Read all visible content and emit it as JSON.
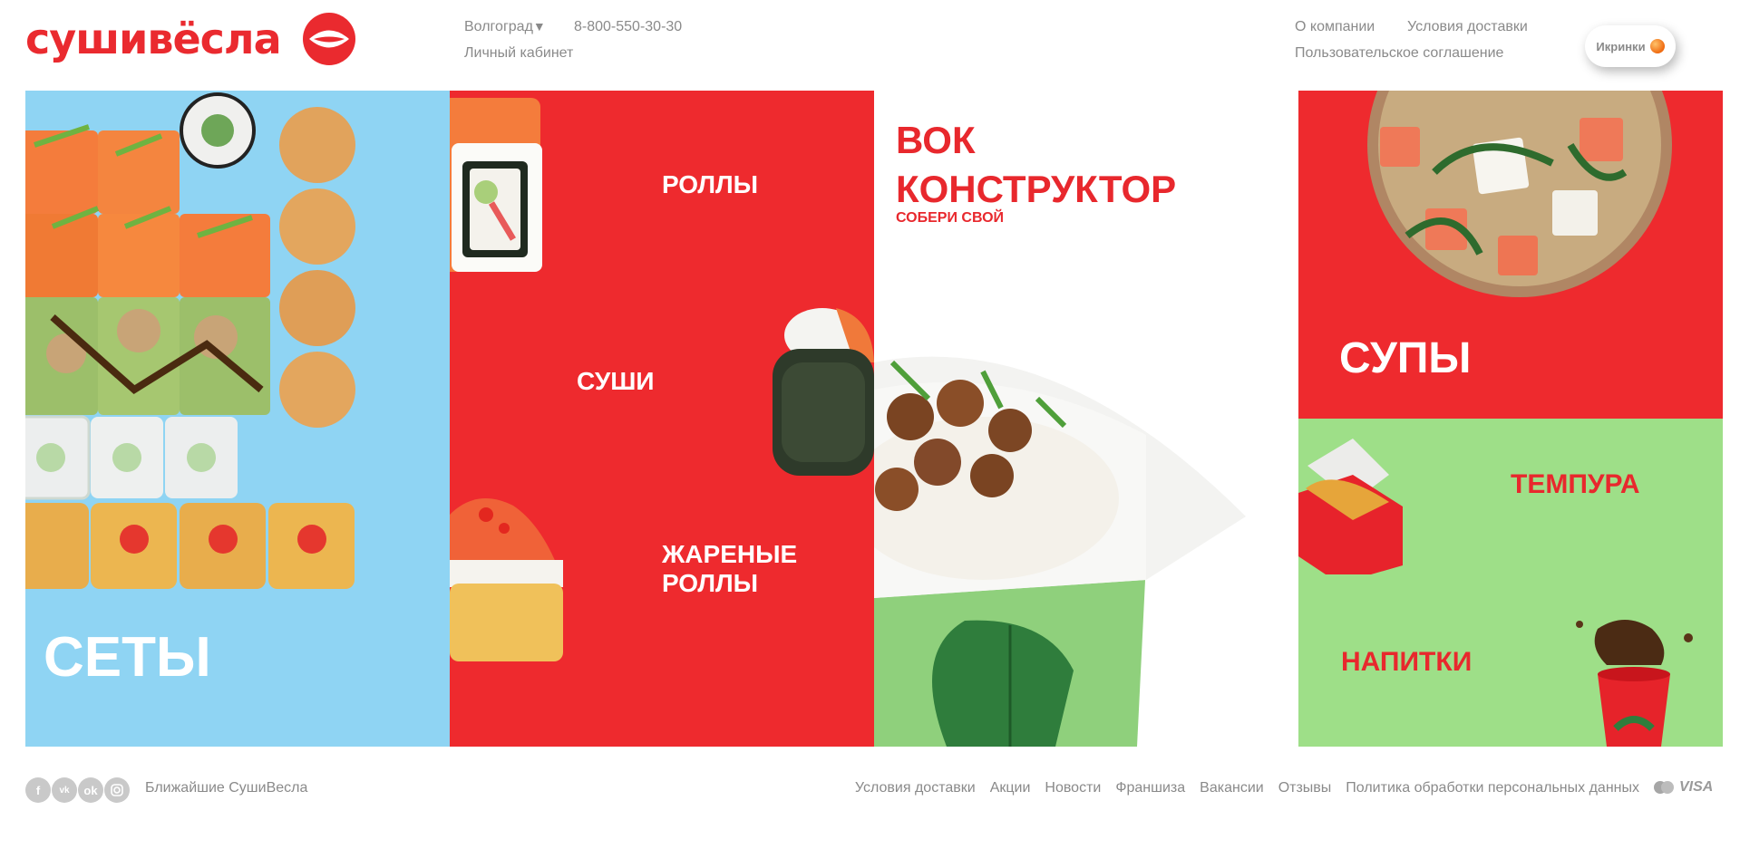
{
  "header": {
    "logo_text": "сушивёсла",
    "city": "Волгоград",
    "city_arrow": "▼",
    "phone": "8-800-550-30-30",
    "cabinet": "Личный кабинет",
    "about": "О компании",
    "delivery": "Условия доставки",
    "agreement": "Пользовательское соглашение",
    "ikrinki": "Икринки"
  },
  "categories": {
    "sets": "СЕТЫ",
    "rolls": "РОЛЛЫ",
    "sushi": "СУШИ",
    "fried_line1": "ЖАРЕНЫЕ",
    "fried_line2": "РОЛЛЫ",
    "wok_line1": "ВОК",
    "wok_line2": "КОНСТРУКТОР",
    "wok_sub": "СОБЕРИ СВОЙ",
    "soups": "СУПЫ",
    "tempura": "ТЕМПУРА",
    "drinks": "НАПИТКИ"
  },
  "footer": {
    "socials": [
      "f",
      "vk",
      "ok",
      "ig"
    ],
    "nearest": "Ближайшие СушиВесла",
    "nav": [
      "Условия доставки",
      "Акции",
      "Новости",
      "Франшиза",
      "Вакансии",
      "Отзывы",
      "Политика обработки персональных данных"
    ],
    "visa": "VISA"
  },
  "colors": {
    "brand_red": "#ea2a2f",
    "sky_blue": "#8fd4f3",
    "green": "#9edf88"
  }
}
